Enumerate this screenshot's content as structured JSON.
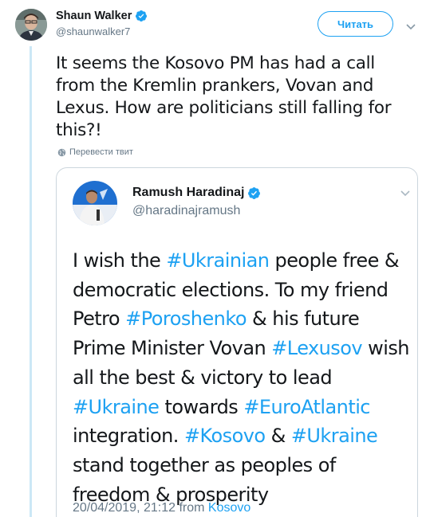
{
  "tweet": {
    "author": {
      "name": "Shaun Walker",
      "handle": "@shaunwalker7"
    },
    "follow_label": "Читать",
    "text": "It seems the Kosovo PM has had a call from the Kremlin prankers, Vovan and Lexus. How are politicians still falling for this?!",
    "translate_label": "Перевести твит"
  },
  "quote": {
    "author": {
      "name": "Ramush Haradinaj",
      "handle": "@haradinajramush"
    },
    "segments": [
      {
        "text": "I wish the ",
        "tag": false
      },
      {
        "text": "#Ukrainian",
        "tag": true
      },
      {
        "text": " people free & democratic elections. To my friend Petro ",
        "tag": false
      },
      {
        "text": "#Poroshenko",
        "tag": true
      },
      {
        "text": " & his future Prime Minister Vovan ",
        "tag": false
      },
      {
        "text": "#Lexusov",
        "tag": true
      },
      {
        "text": " wish all the best & victory to lead ",
        "tag": false
      },
      {
        "text": "#Ukraine",
        "tag": true
      },
      {
        "text": " towards ",
        "tag": false
      },
      {
        "text": "#EuroAtlantic",
        "tag": true
      },
      {
        "text": " integration. ",
        "tag": false
      },
      {
        "text": "#Kosovo",
        "tag": true
      },
      {
        "text": " & ",
        "tag": false
      },
      {
        "text": "#Ukraine",
        "tag": true
      },
      {
        "text": " stand together as peoples of freedom & prosperity",
        "tag": false
      }
    ],
    "timestamp": "20/04/2019, 21:12",
    "from_label": "from",
    "location": "Kosovo"
  },
  "icons": [
    "verified-badge-icon",
    "chevron-down-icon",
    "globe-icon"
  ],
  "colors": {
    "accent": "#1da1f2",
    "text": "#14171a",
    "muted": "#657786",
    "thread": "#cce8f6"
  }
}
